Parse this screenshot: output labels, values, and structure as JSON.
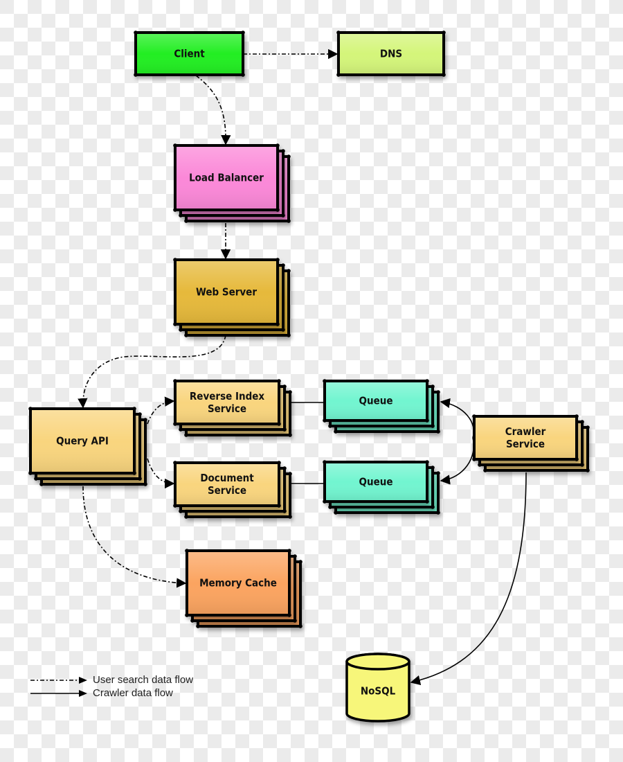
{
  "nodes": {
    "client": {
      "label": [
        "Client"
      ],
      "color": "#22ee22",
      "stacked": false
    },
    "dns": {
      "label": [
        "DNS"
      ],
      "color": "#d4f57a",
      "stacked": false
    },
    "load_balancer": {
      "label": [
        "Load Balancer"
      ],
      "color": "#fb88d8",
      "stacked": true
    },
    "web_server": {
      "label": [
        "Web Server"
      ],
      "color": "#e6b93a",
      "stacked": true
    },
    "query_api": {
      "label": [
        "Query API"
      ],
      "color": "#f9d57e",
      "stacked": true
    },
    "reverse_index": {
      "label": [
        "Reverse Index",
        "Service"
      ],
      "color": "#f9d57e",
      "stacked": true
    },
    "document": {
      "label": [
        "Document",
        "Service"
      ],
      "color": "#f9d57e",
      "stacked": true
    },
    "queue_top": {
      "label": [
        "Queue"
      ],
      "color": "#72f5d0",
      "stacked": true
    },
    "queue_bottom": {
      "label": [
        "Queue"
      ],
      "color": "#72f5d0",
      "stacked": true
    },
    "crawler": {
      "label": [
        "Crawler",
        "Service"
      ],
      "color": "#f9d57e",
      "stacked": true
    },
    "memory_cache": {
      "label": [
        "Memory Cache"
      ],
      "color": "#fba461",
      "stacked": true
    },
    "nosql": {
      "label": [
        "NoSQL"
      ],
      "color": "#f7f67a",
      "shape": "cylinder"
    }
  },
  "edges": [
    {
      "from": "client",
      "to": "dns",
      "style": "user-search"
    },
    {
      "from": "client",
      "to": "load_balancer",
      "style": "user-search"
    },
    {
      "from": "load_balancer",
      "to": "web_server",
      "style": "user-search"
    },
    {
      "from": "web_server",
      "to": "query_api",
      "style": "user-search"
    },
    {
      "from": "query_api",
      "to": "reverse_index",
      "style": "user-search"
    },
    {
      "from": "query_api",
      "to": "document",
      "style": "user-search"
    },
    {
      "from": "query_api",
      "to": "memory_cache",
      "style": "user-search"
    },
    {
      "from": "queue_top",
      "to": "reverse_index",
      "style": "crawler"
    },
    {
      "from": "queue_bottom",
      "to": "document",
      "style": "crawler"
    },
    {
      "from": "crawler",
      "to": "queue_top",
      "style": "crawler"
    },
    {
      "from": "crawler",
      "to": "queue_bottom",
      "style": "crawler"
    },
    {
      "from": "crawler",
      "to": "nosql",
      "style": "crawler"
    }
  ],
  "legend": {
    "user_search": "User search data flow",
    "crawler": "Crawler data flow"
  }
}
